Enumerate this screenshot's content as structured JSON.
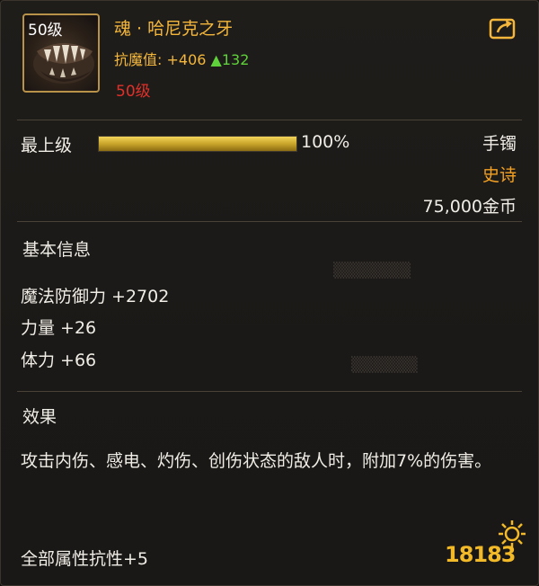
{
  "item": {
    "icon_level": "50级",
    "name": "魂 · 哈尼克之牙",
    "stat_label": "抗魔值:",
    "stat_value": "+406",
    "stat_increase": "▲132",
    "level_requirement": "50级",
    "share_icon": "share-arrow-icon"
  },
  "upgrade": {
    "label": "最上级",
    "progress_percent": 100,
    "percent_text": "100%"
  },
  "meta": {
    "slot": "手镯",
    "rarity": "史诗",
    "price": "75,000金币"
  },
  "basic_info": {
    "title": "基本信息",
    "attributes": [
      "魔法防御力 +2702",
      "力量 +26",
      "体力 +66"
    ]
  },
  "effect": {
    "title": "效果",
    "description": "攻击内伤、感电、灼伤、创伤状态的敌人时，附加7%的伤害。",
    "extra": "全部属性抗性+5"
  },
  "watermark": {
    "text": "18183"
  },
  "colors": {
    "gold": "#f4b73c",
    "epic": "#f4a123",
    "level_red": "#e0302a",
    "increase_green": "#5fd13a",
    "frame": "#b9924a"
  }
}
